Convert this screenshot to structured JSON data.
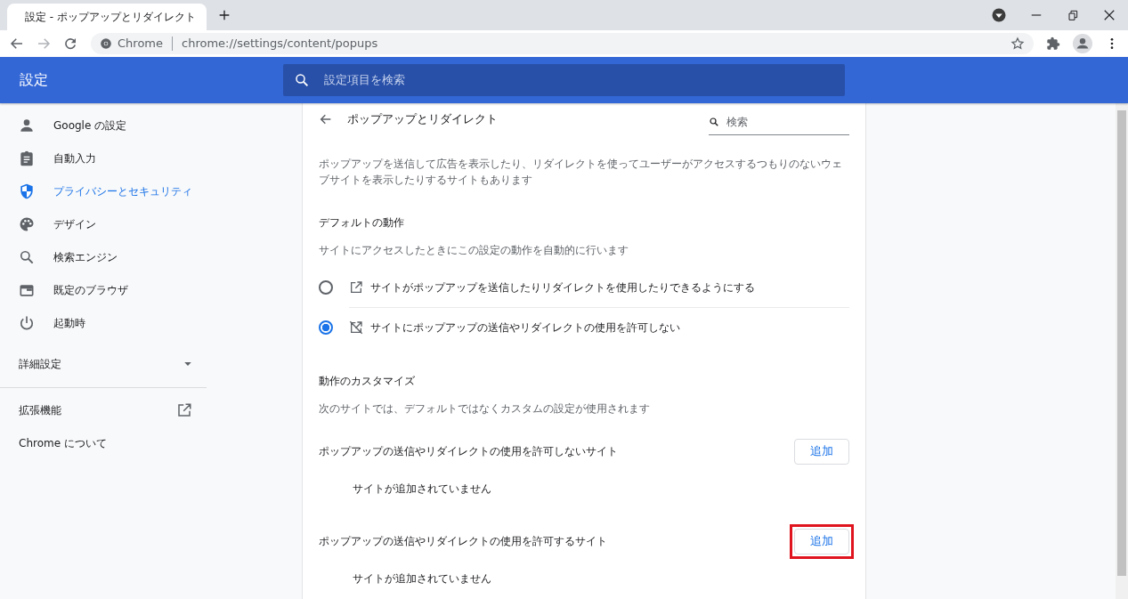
{
  "browser": {
    "tab": {
      "title": "設定 - ポップアップとリダイレクト",
      "selected": true
    },
    "address": {
      "site_label": "Chrome",
      "url": "chrome://settings/content/popups"
    }
  },
  "header": {
    "title": "設定",
    "search_placeholder": "設定項目を検索"
  },
  "sidebar": {
    "items": [
      {
        "label": "Google の設定",
        "selected": false
      },
      {
        "label": "自動入力",
        "selected": false
      },
      {
        "label": "プライバシーとセキュリティ",
        "selected": true
      },
      {
        "label": "デザイン",
        "selected": false
      },
      {
        "label": "検索エンジン",
        "selected": false
      },
      {
        "label": "既定のブラウザ",
        "selected": false
      },
      {
        "label": "起動時",
        "selected": false
      }
    ],
    "advanced": {
      "label": "詳細設定",
      "expanded": false
    },
    "links": [
      {
        "label": "拡張機能"
      },
      {
        "label": "Chrome について"
      }
    ]
  },
  "page": {
    "title": "ポップアップとリダイレクト",
    "search": {
      "placeholder": "検索"
    },
    "description": "ポップアップを送信して広告を表示したり、リダイレクトを使ってユーザーがアクセスするつもりのないウェブサイトを表示したりするサイトもあります",
    "default_behavior": {
      "heading": "デフォルトの動作",
      "subheading": "サイトにアクセスしたときにこの設定の動作を自動的に行います",
      "options": [
        {
          "label": "サイトがポップアップを送信したりリダイレクトを使用したりできるようにする",
          "selected": false
        },
        {
          "label": "サイトにポップアップの送信やリダイレクトの使用を許可しない",
          "selected": true
        }
      ]
    },
    "customize": {
      "heading": "動作のカスタマイズ",
      "subheading": "次のサイトでは、デフォルトではなくカスタムの設定が使用されます",
      "lists": [
        {
          "title": "ポップアップの送信やリダイレクトの使用を許可しないサイト",
          "button": "追加",
          "empty": "サイトが追加されていません",
          "highlighted": false
        },
        {
          "title": "ポップアップの送信やリダイレクトの使用を許可するサイト",
          "button": "追加",
          "empty": "サイトが追加されていません",
          "highlighted": true
        }
      ]
    }
  }
}
